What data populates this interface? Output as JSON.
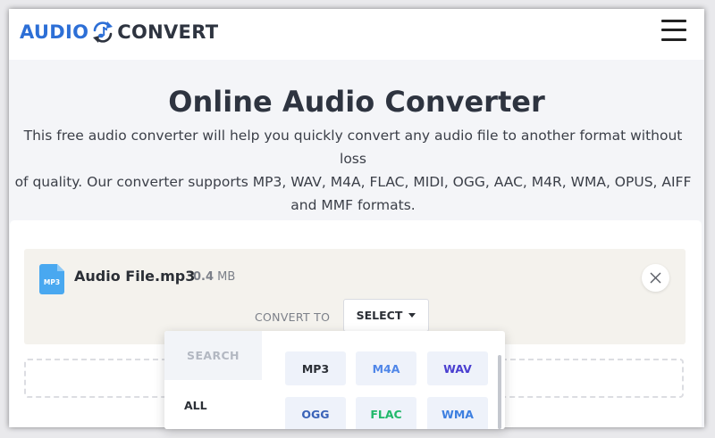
{
  "header": {
    "logo_part1": "AUDIO",
    "logo_part2": "CONVERT",
    "logo_icon": "music-note-refresh-icon",
    "menu_icon": "hamburger-menu-icon"
  },
  "hero": {
    "title": "Online Audio Converter",
    "description_lines": [
      "This free audio converter will help you quickly convert any audio file to another format without loss",
      "of quality. Our converter supports MP3, WAV, M4A, FLAC, MIDI, OGG, AAC, M4R, WMA, OPUS, AIFF",
      "and MMF formats."
    ]
  },
  "file": {
    "icon_label": "MP3",
    "name": "Audio File.mp3",
    "size_value": "0.4",
    "size_unit": "MB",
    "close_icon": "close-icon"
  },
  "converter": {
    "convert_to_label": "CONVERT TO",
    "select_label": "SELECT"
  },
  "dropdown": {
    "search_label": "SEARCH",
    "category_all": "ALL",
    "formats": [
      {
        "label": "MP3",
        "color": "#2b2f36"
      },
      {
        "label": "M4A",
        "color": "#4f86e8"
      },
      {
        "label": "WAV",
        "color": "#4a3fd0"
      },
      {
        "label": "OGG",
        "color": "#3a63b8"
      },
      {
        "label": "FLAC",
        "color": "#20b86a"
      },
      {
        "label": "WMA",
        "color": "#3d7fe0"
      }
    ]
  },
  "colors": {
    "brand_blue": "#2d6fd6",
    "brand_dark": "#2e3440",
    "file_icon": "#49a8f0"
  }
}
